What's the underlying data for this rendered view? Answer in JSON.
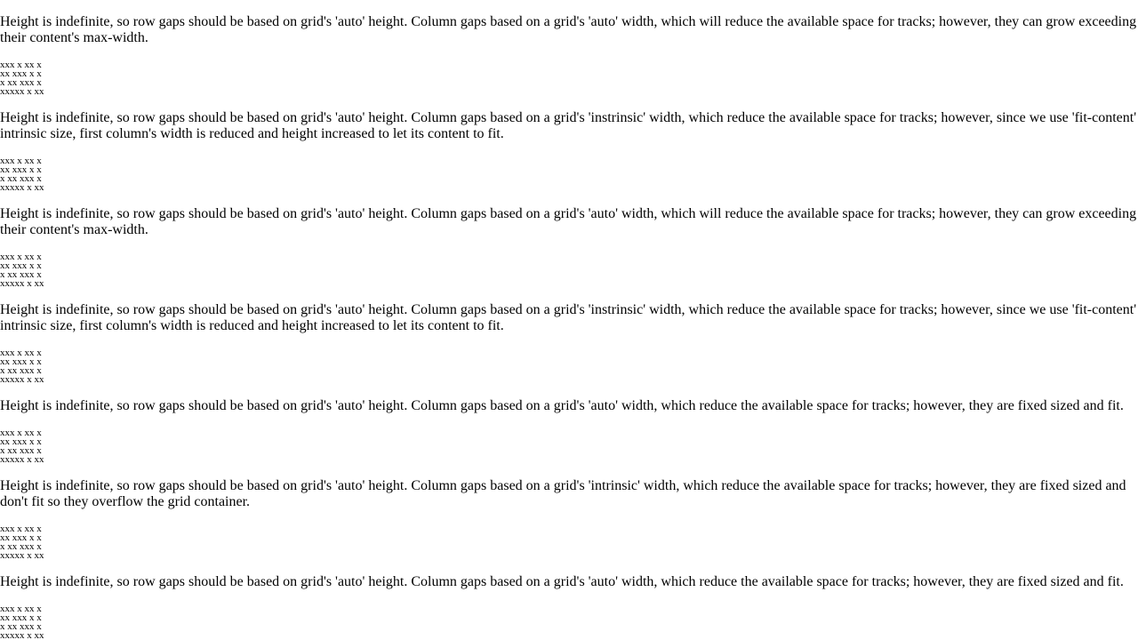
{
  "sections": [
    {
      "description": "Height is indefinite, so row gaps should be based on grid's 'auto' height. Column gaps based on a grid's 'auto' width, which will reduce the available space for tracks; however, they can grow exceeding their content's max-width.",
      "rows": [
        "xxx x xx x",
        "xx xxx x x",
        "x xx xxx x",
        "xxxxx x xx"
      ]
    },
    {
      "description": "Height is indefinite, so row gaps should be based on grid's 'auto' height. Column gaps based on a grid's 'instrinsic' width, which reduce the available space for tracks; however, since we use 'fit-content' intrinsic size, first column's width is reduced and height increased to let its content to fit.",
      "rows": [
        "xxx x xx x",
        "xx xxx x x",
        "x xx xxx x",
        "xxxxx x xx"
      ]
    },
    {
      "description": "Height is indefinite, so row gaps should be based on grid's 'auto' height. Column gaps based on a grid's 'auto' width, which will reduce the available space for tracks; however, they can grow exceeding their content's max-width.",
      "rows": [
        "xxx x xx x",
        "xx xxx x x",
        "x xx xxx x",
        "xxxxx x xx"
      ]
    },
    {
      "description": "Height is indefinite, so row gaps should be based on grid's 'auto' height. Column gaps based on a grid's 'instrinsic' width, which reduce the available space for tracks; however, since we use 'fit-content' intrinsic size, first column's width is reduced and height increased to let its content to fit.",
      "rows": [
        "xxx x xx x",
        "xx xxx x x",
        "x xx xxx x",
        "xxxxx x xx"
      ]
    },
    {
      "description": "Height is indefinite, so row gaps should be based on grid's 'auto' height. Column gaps based on a grid's 'auto' width, which reduce the available space for tracks; however, they are fixed sized and fit.",
      "rows": [
        "xxx x xx x",
        "xx xxx x x",
        "x xx xxx x",
        "xxxxx x xx"
      ]
    },
    {
      "description": "Height is indefinite, so row gaps should be based on grid's 'auto' height. Column gaps based on a grid's 'intrinsic' width, which reduce the available space for tracks; however, they are fixed sized and don't fit so they overflow the grid container.",
      "rows": [
        "xxx x xx x",
        "xx xxx x x",
        "x xx xxx x",
        "xxxxx x xx"
      ]
    },
    {
      "description": "Height is indefinite, so row gaps should be based on grid's 'auto' height. Column gaps based on a grid's 'auto' width, which reduce the available space for tracks; however, they are fixed sized and fit.",
      "rows": [
        "xxx x xx x",
        "xx xxx x x",
        "x xx xxx x",
        "xxxxx x xx"
      ]
    }
  ]
}
